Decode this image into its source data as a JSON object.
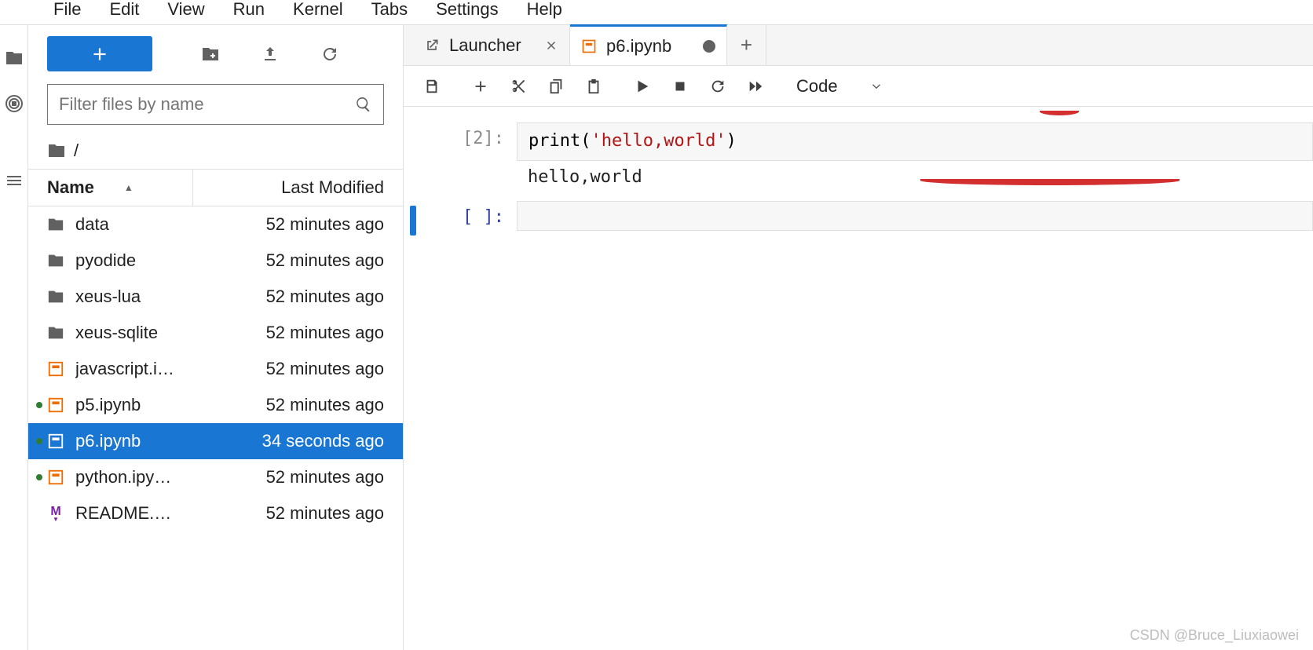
{
  "menubar": {
    "items": [
      "File",
      "Edit",
      "View",
      "Run",
      "Kernel",
      "Tabs",
      "Settings",
      "Help"
    ]
  },
  "file_panel": {
    "filter_placeholder": "Filter files by name",
    "breadcrumb": "/",
    "columns": {
      "name": "Name",
      "modified": "Last Modified"
    },
    "files": [
      {
        "type": "folder",
        "name": "data",
        "modified": "52 minutes ago",
        "running": false,
        "selected": false
      },
      {
        "type": "folder",
        "name": "pyodide",
        "modified": "52 minutes ago",
        "running": false,
        "selected": false
      },
      {
        "type": "folder",
        "name": "xeus-lua",
        "modified": "52 minutes ago",
        "running": false,
        "selected": false
      },
      {
        "type": "folder",
        "name": "xeus-sqlite",
        "modified": "52 minutes ago",
        "running": false,
        "selected": false
      },
      {
        "type": "notebook",
        "name": "javascript.i…",
        "modified": "52 minutes ago",
        "running": false,
        "selected": false
      },
      {
        "type": "notebook",
        "name": "p5.ipynb",
        "modified": "52 minutes ago",
        "running": true,
        "selected": false
      },
      {
        "type": "notebook",
        "name": "p6.ipynb",
        "modified": "34 seconds ago",
        "running": true,
        "selected": true
      },
      {
        "type": "notebook",
        "name": "python.ipy…",
        "modified": "52 minutes ago",
        "running": true,
        "selected": false
      },
      {
        "type": "markdown",
        "name": "README.…",
        "modified": "52 minutes ago",
        "running": false,
        "selected": false
      }
    ]
  },
  "tabs": [
    {
      "type": "launcher",
      "label": "Launcher",
      "active": false,
      "dirty": false
    },
    {
      "type": "notebook",
      "label": "p6.ipynb",
      "active": true,
      "dirty": true
    }
  ],
  "cell_type_selector": "Code",
  "cells": [
    {
      "prompt": "[2]:",
      "code_prefix": "print(",
      "code_str": "'hello,world'",
      "code_suffix": ")",
      "output": "hello,world",
      "active": false
    },
    {
      "prompt": "[ ]:",
      "code_prefix": "",
      "code_str": "",
      "code_suffix": "",
      "output": "",
      "active": true
    }
  ],
  "watermark": "CSDN @Bruce_Liuxiaowei"
}
